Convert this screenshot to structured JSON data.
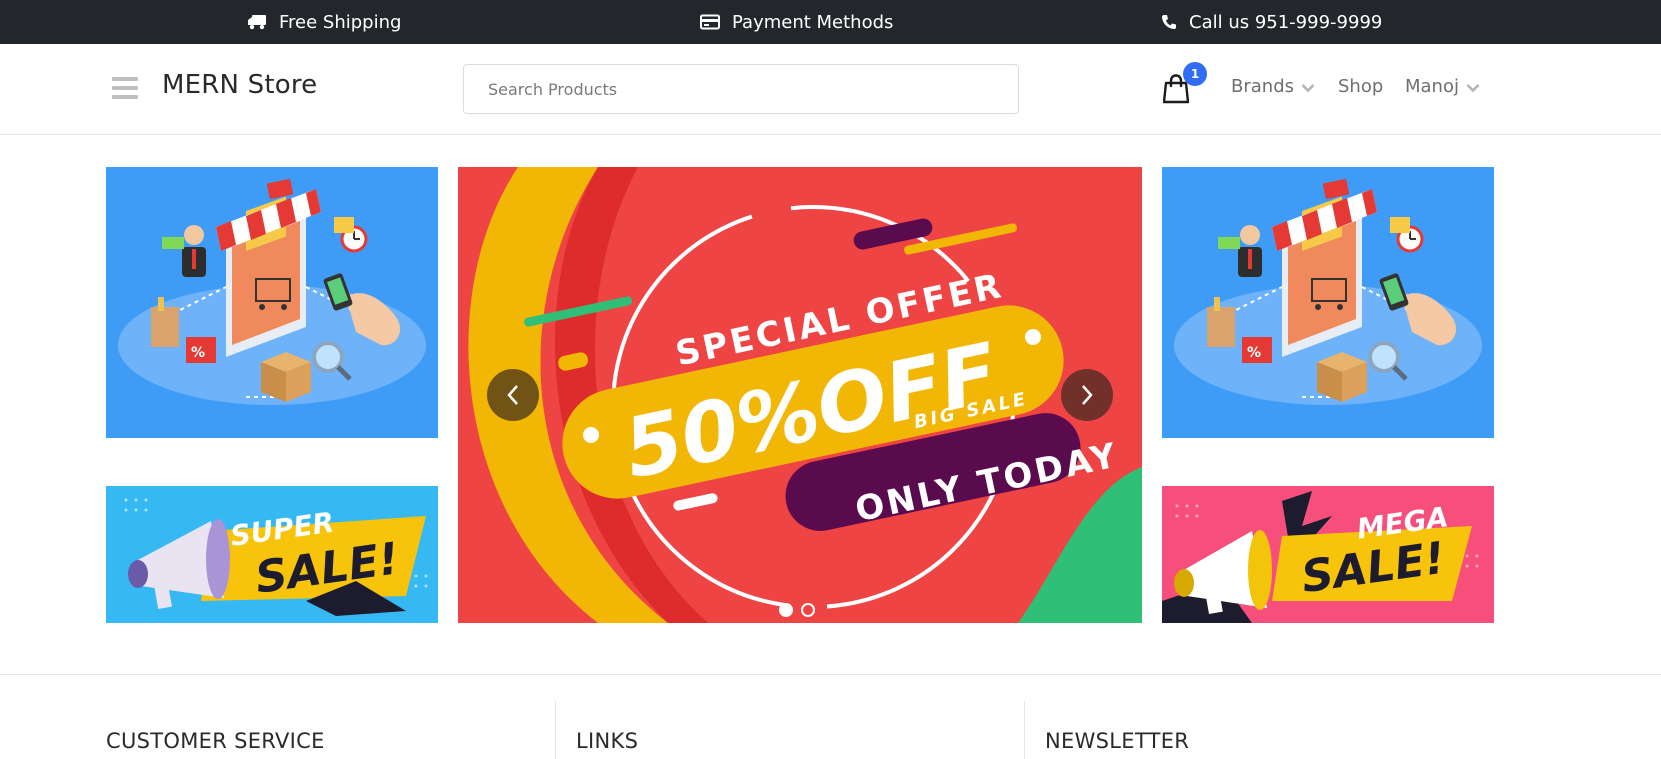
{
  "topbar": {
    "shipping": "Free Shipping",
    "payment": "Payment Methods",
    "call": "Call us 951-999-9999"
  },
  "header": {
    "logo": "MERN Store",
    "search_placeholder": "Search Products",
    "cart_count": "1",
    "nav": {
      "brands": "Brands",
      "shop": "Shop",
      "user": "Manoj"
    }
  },
  "hero": {
    "carousel": {
      "line1": "SPECIAL OFFER",
      "line2": "50%OFF",
      "line3": "BIG SALE",
      "line4": "ONLY TODAY",
      "active_slide": 1,
      "slide_count": 2
    },
    "banner_bottom_left": {
      "word1": "SUPER",
      "word2": "SALE!"
    },
    "banner_bottom_right": {
      "word1": "MEGA",
      "word2": "SALE!"
    }
  },
  "footer": {
    "customer_service": "CUSTOMER SERVICE",
    "links": "LINKS",
    "newsletter": "NEWSLETTER"
  },
  "colors": {
    "topbar": "#23272b",
    "badge": "#2f6df6",
    "carousel_bg": "#ee4444",
    "accent_yellow": "#f2b705",
    "accent_purple": "#5a0b4d"
  },
  "icons": [
    "truck-icon",
    "credit-card-icon",
    "phone-icon",
    "hamburger-menu-icon",
    "shopping-bag-icon",
    "chevron-down-icon",
    "chevron-left-icon",
    "chevron-right-icon"
  ]
}
